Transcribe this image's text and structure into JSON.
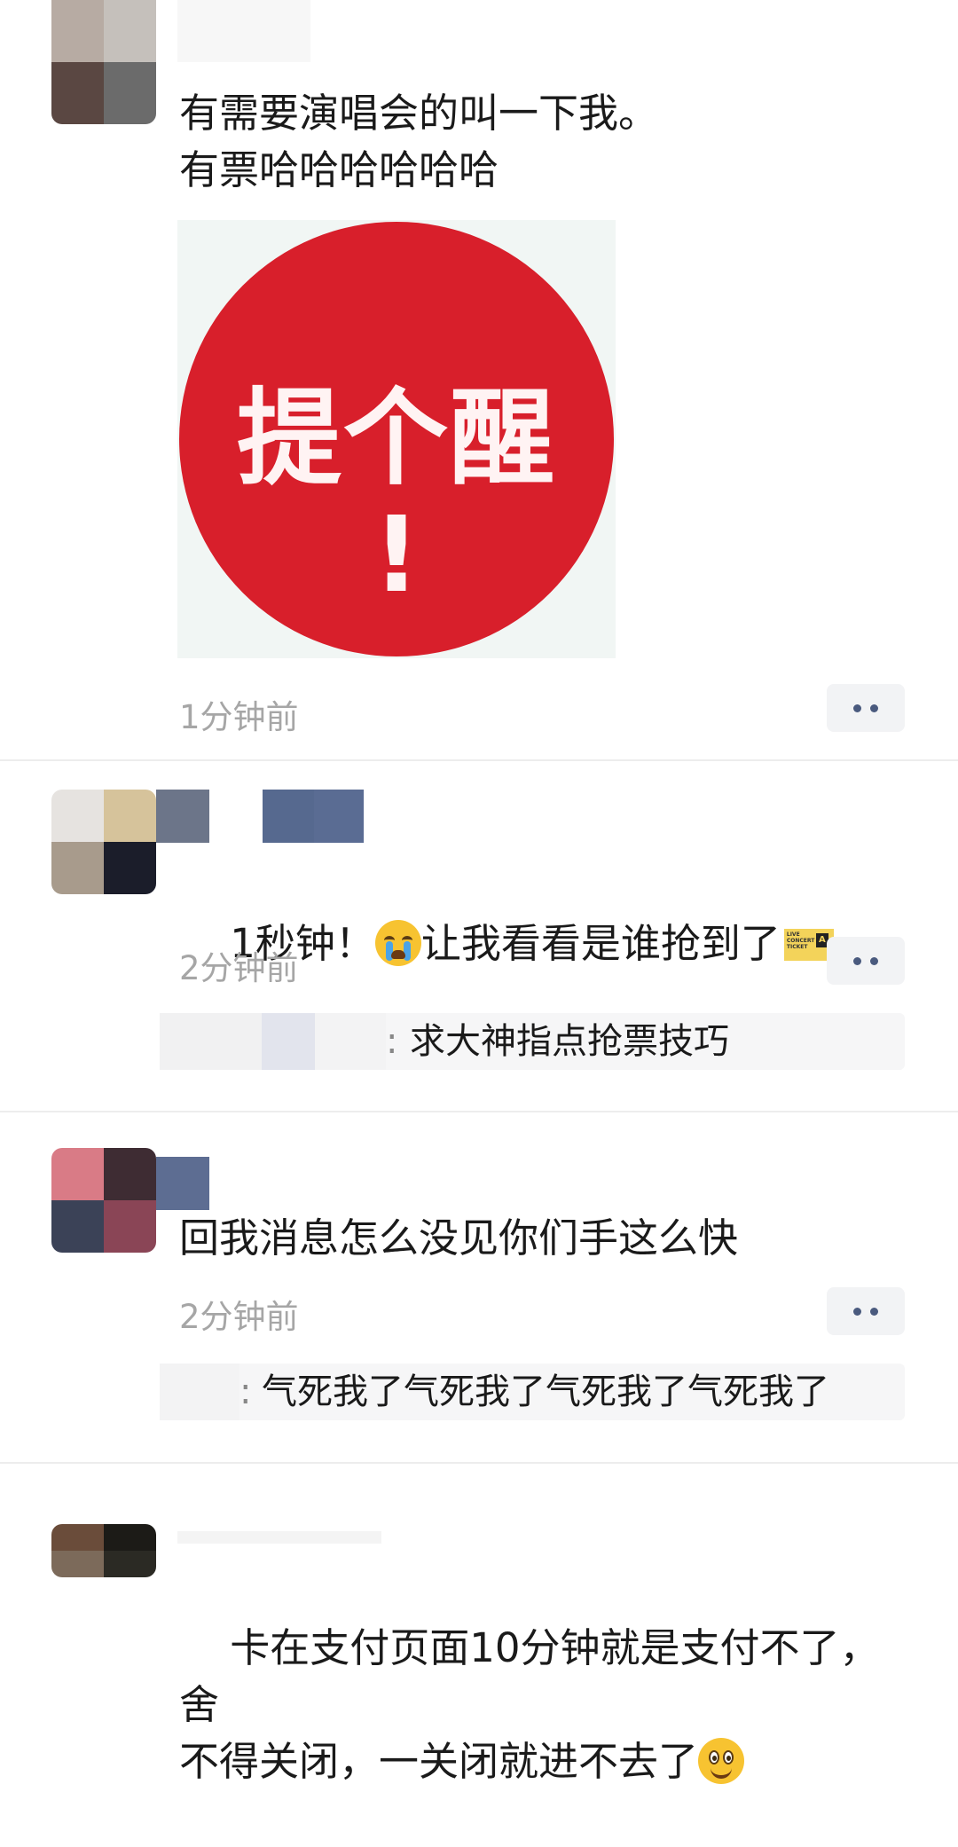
{
  "comments": [
    {
      "text": "有需要演唱会的叫一下我。\n有票哈哈哈哈哈哈",
      "sticker": {
        "line1": "提个醒",
        "line2": "!"
      },
      "time": "1分钟前",
      "more_icon": "more-dots-icon"
    },
    {
      "text_before": "1秒钟！",
      "emoji1": "loudly-crying-face-icon",
      "text_after": "让我看看是谁抢到了",
      "ticket_icon": {
        "name": "concert-ticket-icon",
        "lines": "LIVE\nCONCERT\nTICKET",
        "badge": "A"
      },
      "time": "2分钟前",
      "reply": {
        "text": "求大神指点抢票技巧",
        "separator": ":"
      }
    },
    {
      "text": "回我消息怎么没见你们手这么快",
      "time": "2分钟前",
      "reply": {
        "text": "气死我了气死我了气死我了气死我了",
        "separator": ":"
      }
    },
    {
      "text_before": "卡在支付页面10分钟就是支付不了，舍\n不得关闭，一关闭就进不去了",
      "emoji": "smiling-face-icon"
    }
  ],
  "colors": {
    "sticker_red": "#d81f2b",
    "time_gray": "#a6a6a6",
    "dots_blue": "#4a5a7e"
  }
}
